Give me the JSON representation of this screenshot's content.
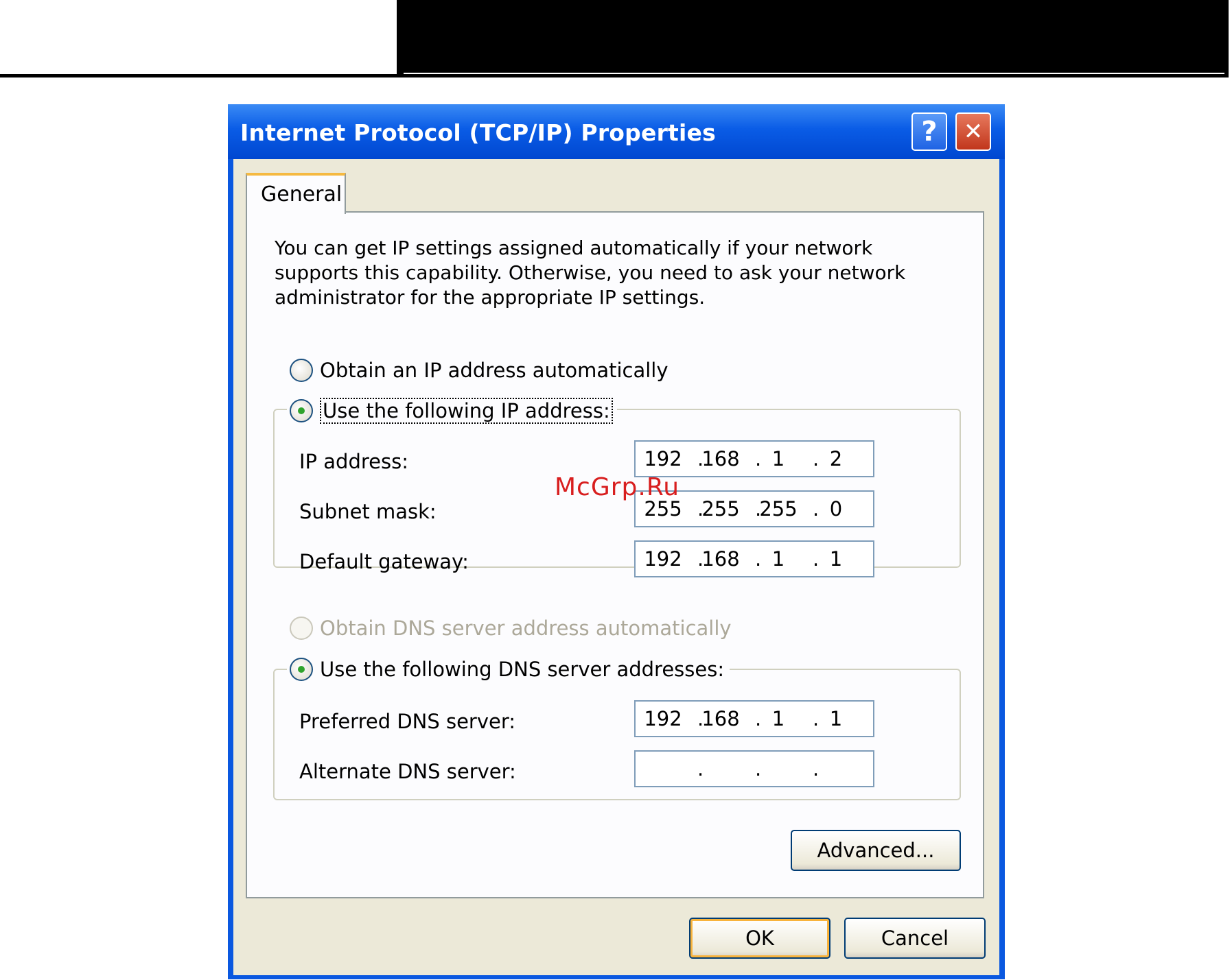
{
  "window": {
    "title": "Internet Protocol (TCP/IP) Properties",
    "help_label": "?",
    "close_label": "✕"
  },
  "tabs": [
    {
      "label": "General"
    }
  ],
  "intro_text": "You can get IP settings assigned automatically if your network supports this capability. Otherwise, you need to ask your network administrator for the appropriate IP settings.",
  "ip_mode": {
    "auto": {
      "label": "Obtain an IP address automatically",
      "checked": false
    },
    "manual": {
      "label": "Use the following IP address:",
      "checked": true
    }
  },
  "ip_fields": [
    {
      "label": "IP address:",
      "octets": [
        "192",
        "168",
        "1",
        "2"
      ]
    },
    {
      "label": "Subnet mask:",
      "octets": [
        "255",
        "255",
        "255",
        "0"
      ]
    },
    {
      "label": "Default gateway:",
      "octets": [
        "192",
        "168",
        "1",
        "1"
      ]
    }
  ],
  "dns_mode": {
    "auto": {
      "label": "Obtain DNS server address automatically",
      "checked": false,
      "disabled": true
    },
    "manual": {
      "label": "Use the following DNS server addresses:",
      "checked": true
    }
  },
  "dns_fields": [
    {
      "label": "Preferred DNS server:",
      "octets": [
        "192",
        "168",
        "1",
        "1"
      ]
    },
    {
      "label": "Alternate DNS server:",
      "octets": [
        "",
        "",
        "",
        ""
      ]
    }
  ],
  "buttons": {
    "advanced": "Advanced...",
    "ok": "OK",
    "cancel": "Cancel"
  },
  "watermark": "McGrp.Ru"
}
